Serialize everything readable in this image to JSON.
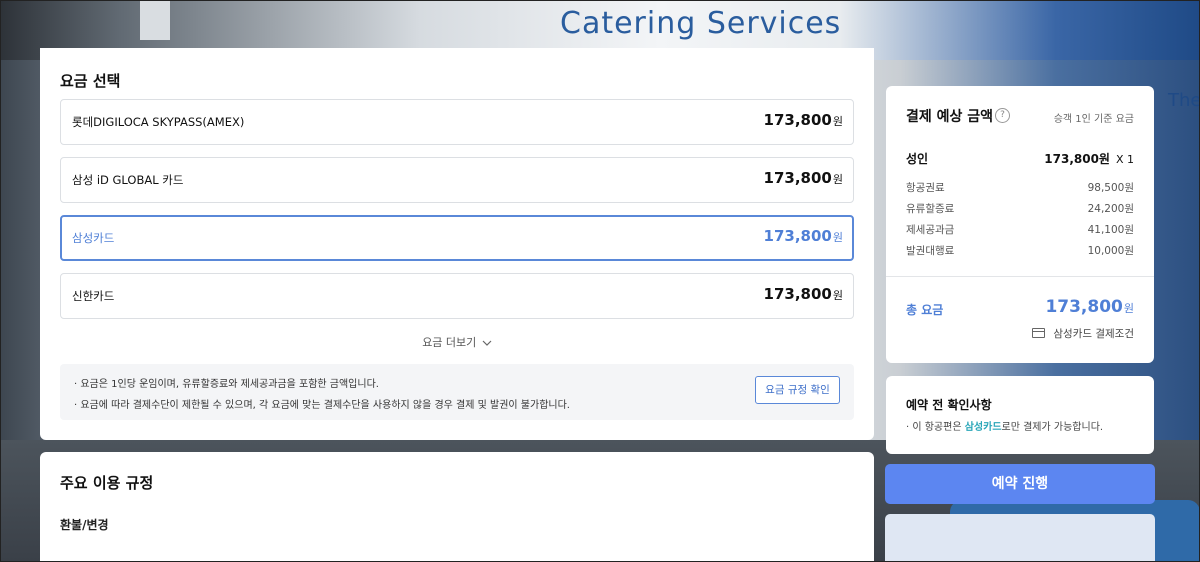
{
  "background": {
    "plane_text": "Catering Services",
    "plane_text2": "The"
  },
  "fare_select": {
    "title": "요금 선택",
    "options": [
      {
        "name": "롯데DIGILOCA SKYPASS(AMEX)",
        "price": "173,800",
        "unit": "원",
        "selected": false
      },
      {
        "name": "삼성 iD GLOBAL 카드",
        "price": "173,800",
        "unit": "원",
        "selected": false
      },
      {
        "name": "삼성카드",
        "price": "173,800",
        "unit": "원",
        "selected": true
      },
      {
        "name": "신한카드",
        "price": "173,800",
        "unit": "원",
        "selected": false
      }
    ],
    "more_label": "요금 더보기",
    "notice": [
      "· 요금은 1인당 운임이며, 유류할증료와 제세공과금을 포함한 금액입니다.",
      "· 요금에 따라 결제수단이 제한될 수 있으며, 각 요금에 맞는 결제수단을 사용하지 않을 경우 결제 및 발권이 불가합니다."
    ],
    "rules_button": "요금 규정 확인"
  },
  "rules": {
    "title": "주요 이용 규정",
    "sub": "환불/변경"
  },
  "summary": {
    "title": "결제 예상 금액",
    "help_glyph": "?",
    "basis": "승객 1인 기준 요금",
    "adult_label": "성인",
    "adult_price": "173,800원",
    "adult_mult": "X 1",
    "breakdown": [
      {
        "label": "항공권료",
        "value": "98,500원"
      },
      {
        "label": "유류할증료",
        "value": "24,200원"
      },
      {
        "label": "제세공과금",
        "value": "41,100원"
      },
      {
        "label": "발권대행료",
        "value": "10,000원"
      }
    ],
    "total_label": "총 요금",
    "total_price": "173,800",
    "total_unit": "원",
    "payment_condition": "삼성카드 결제조건"
  },
  "confirm": {
    "title": "예약 전 확인사항",
    "prefix": "· 이 항공편은 ",
    "highlight": "삼성카드",
    "suffix": "로만 결제가 가능합니다."
  },
  "proceed_label": "예약 진행",
  "colors": {
    "accent": "#5c86f1",
    "selected": "#4f7fd6",
    "highlight": "#2aa6b8"
  }
}
